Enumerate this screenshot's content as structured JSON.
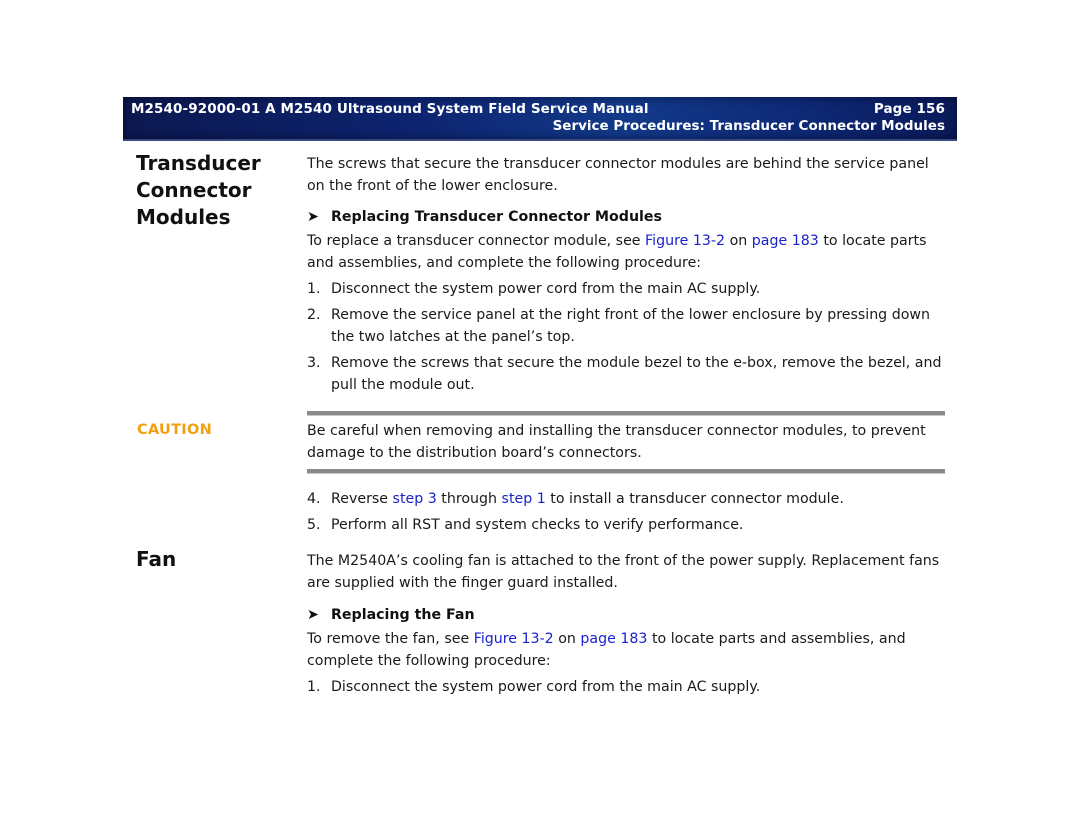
{
  "header": {
    "title": "M2540-92000-01 A M2540 Ultrasound System Field Service Manual",
    "page": "Page 156",
    "section": "Service Procedures: Transducer Connector Modules"
  },
  "section1": {
    "heading_lines": [
      "Transducer",
      "Connector",
      "Modules"
    ],
    "intro": "The screws that secure the transducer connector modules are behind the service panel on the front of the lower enclosure.",
    "subheading": "Replacing Transducer Connector Modules",
    "procedure_intro": {
      "before": "To replace a transducer connector module, see ",
      "link_figure": "Figure 13-2",
      "middle": " on ",
      "link_page": "page 183",
      "after": " to locate parts and assemblies, and complete the following procedure:"
    },
    "steps": [
      {
        "num": "1.",
        "text": "Disconnect the system power cord from the main AC supply."
      },
      {
        "num": "2.",
        "text": "Remove the service panel at the right front of the lower enclosure by pressing down the two latches at the panel’s top."
      },
      {
        "num": "3.",
        "text": "Remove the screws that secure the module bezel to the e-box, remove the bezel, and pull the module out."
      }
    ],
    "caution": {
      "label": "CAUTION",
      "text": "Be careful when removing and installing the transducer connector modules, to prevent damage to the distribution board’s connectors."
    },
    "step4": {
      "num": "4.",
      "before": "Reverse ",
      "link1": "step 3",
      "middle": " through ",
      "link2": "step 1",
      "after": " to install a transducer connector module."
    },
    "step5": {
      "num": "5.",
      "text": "Perform all RST and system checks to verify performance."
    }
  },
  "section2": {
    "heading": "Fan",
    "intro": "The M2540A’s cooling fan is attached to the front of the power supply. Replacement fans are supplied with the finger guard installed.",
    "subheading": "Replacing the Fan",
    "procedure_intro": {
      "before": "To remove the fan, see ",
      "link_figure": "Figure 13-2",
      "middle": " on ",
      "link_page": "page 183",
      "after": " to locate parts and assemblies, and complete the following procedure:"
    },
    "steps": [
      {
        "num": "1.",
        "text": "Disconnect the system power cord from the main AC supply."
      }
    ]
  },
  "icons": {
    "arrow": "➤"
  },
  "colors": {
    "caution": "#f0a010",
    "link": "#1a22cc",
    "header_bg": "#0d2470"
  }
}
